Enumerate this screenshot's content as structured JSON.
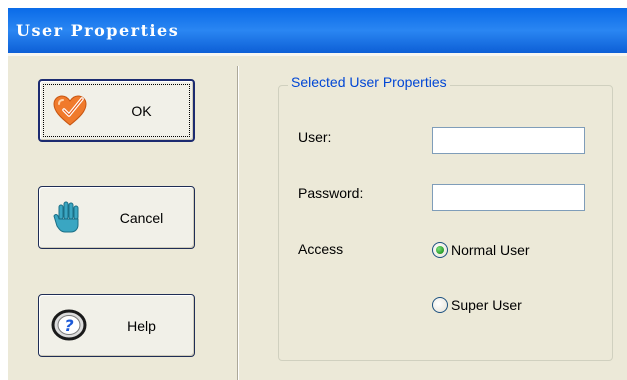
{
  "window": {
    "title": "User Properties"
  },
  "buttons": {
    "ok": {
      "label": "OK",
      "icon": "heart-check-icon"
    },
    "cancel": {
      "label": "Cancel",
      "icon": "stop-hand-icon"
    },
    "help": {
      "label": "Help",
      "icon": "help-question-icon"
    }
  },
  "group": {
    "title": "Selected User Properties",
    "user_label": "User:",
    "user_value": "",
    "password_label": "Password:",
    "password_value": "",
    "access_label": "Access",
    "access_options": [
      {
        "label": "Normal User",
        "selected": true
      },
      {
        "label": "Super User",
        "selected": false
      }
    ]
  },
  "colors": {
    "title_bar": "#2a86f2",
    "dialog_background": "#ece9d8",
    "group_title": "#0046d5",
    "radio_selected": "#2a9c2a"
  }
}
